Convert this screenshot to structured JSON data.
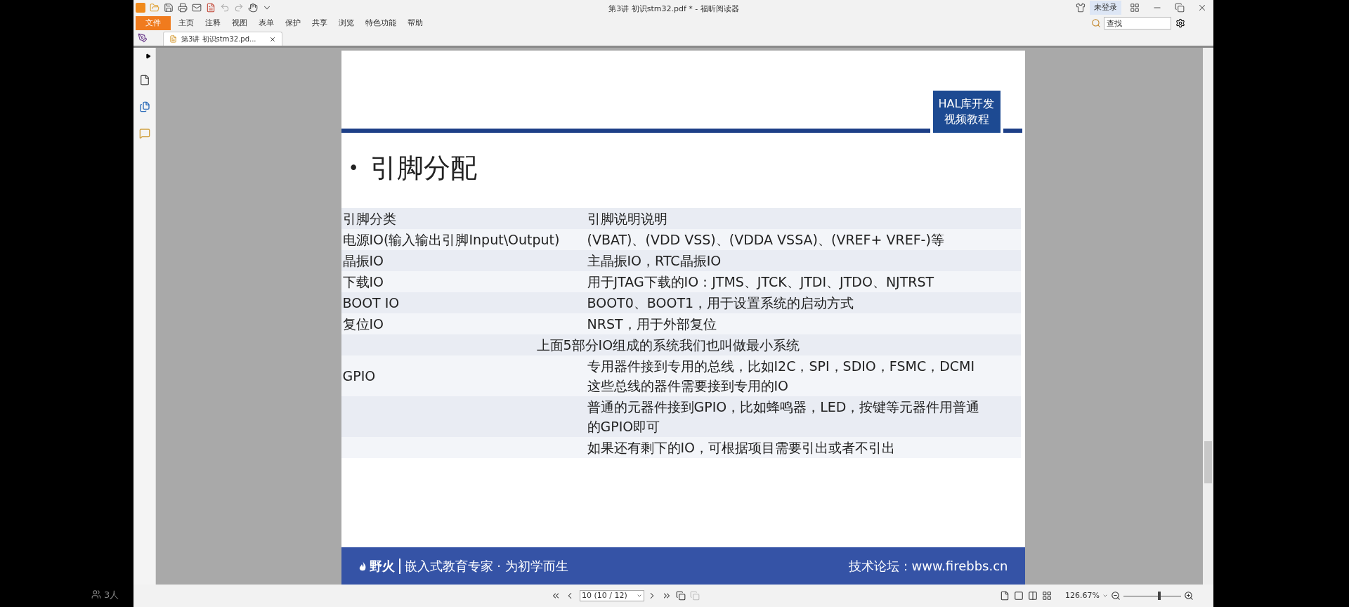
{
  "window": {
    "title": "第3讲 初识stm32.pdf * - 福昕阅读器"
  },
  "menu": [
    {
      "label": "文件",
      "kind": "file"
    },
    {
      "label": "主页",
      "kind": "item"
    },
    {
      "label": "注释",
      "kind": "item"
    },
    {
      "label": "视图",
      "kind": "item"
    },
    {
      "label": "表单",
      "kind": "item"
    },
    {
      "label": "保护",
      "kind": "item"
    },
    {
      "label": "共享",
      "kind": "item"
    },
    {
      "label": "浏览",
      "kind": "item"
    },
    {
      "label": "特色功能",
      "kind": "item"
    },
    {
      "label": "帮助",
      "kind": "item"
    }
  ],
  "account": {
    "label": "未登录"
  },
  "search": {
    "placeholder": "查找"
  },
  "tabs": [
    {
      "label": "第3讲 初识stm32.pd...",
      "selected": true
    }
  ],
  "slide": {
    "badge": [
      "HAL库开发",
      "视频教程"
    ],
    "bullet": "•",
    "title": "引脚分配",
    "rows": [
      {
        "kind": "row",
        "cells": [
          "引脚分类",
          "引脚说明说明"
        ]
      },
      {
        "kind": "row",
        "cells": [
          "电源IO(输入输出引脚Input\\Output)",
          "(VBAT)、(VDD VSS)、(VDDA VSSA)、(VREF+ VREF-)等"
        ]
      },
      {
        "kind": "row",
        "cells": [
          "晶振IO",
          "主晶振IO，RTC晶振IO"
        ]
      },
      {
        "kind": "row",
        "cells": [
          "下载IO",
          "用于JTAG下载的IO：JTMS、JTCK、JTDI、JTDO、NJTRST"
        ]
      },
      {
        "kind": "row",
        "cells": [
          "BOOT IO",
          "BOOT0、BOOT1，用于设置系统的启动方式"
        ]
      },
      {
        "kind": "row",
        "cells": [
          "复位IO",
          "NRST，用于外部复位"
        ]
      },
      {
        "kind": "span",
        "cells": [
          "",
          "上面5部分IO组成的系统我们也叫做最小系统"
        ]
      },
      {
        "kind": "row",
        "cells": [
          "GPIO",
          "专用器件接到专用的总线，比如I2C，SPI，SDIO，FSMC，DCMI这些总线的器件需要接到专用的IO"
        ]
      },
      {
        "kind": "row",
        "cells": [
          "",
          "普通的元器件接到GPIO，比如蜂鸣器，LED，按键等元器件用普通的GPIO即可"
        ]
      },
      {
        "kind": "row",
        "cells": [
          "",
          "如果还有剩下的IO，可根据项目需要引出或者不引出"
        ]
      }
    ],
    "footer": {
      "brand": "野火",
      "tagline": "嵌入式教育专家 · 为初学而生",
      "forum": "技术论坛：www.firebbs.cn"
    }
  },
  "status_bar": {
    "page": "10 (10 / 12)",
    "zoom": "126.67%",
    "zoom_slider": {
      "level": 0.62
    }
  },
  "overlay": {
    "viewers": "3人"
  }
}
